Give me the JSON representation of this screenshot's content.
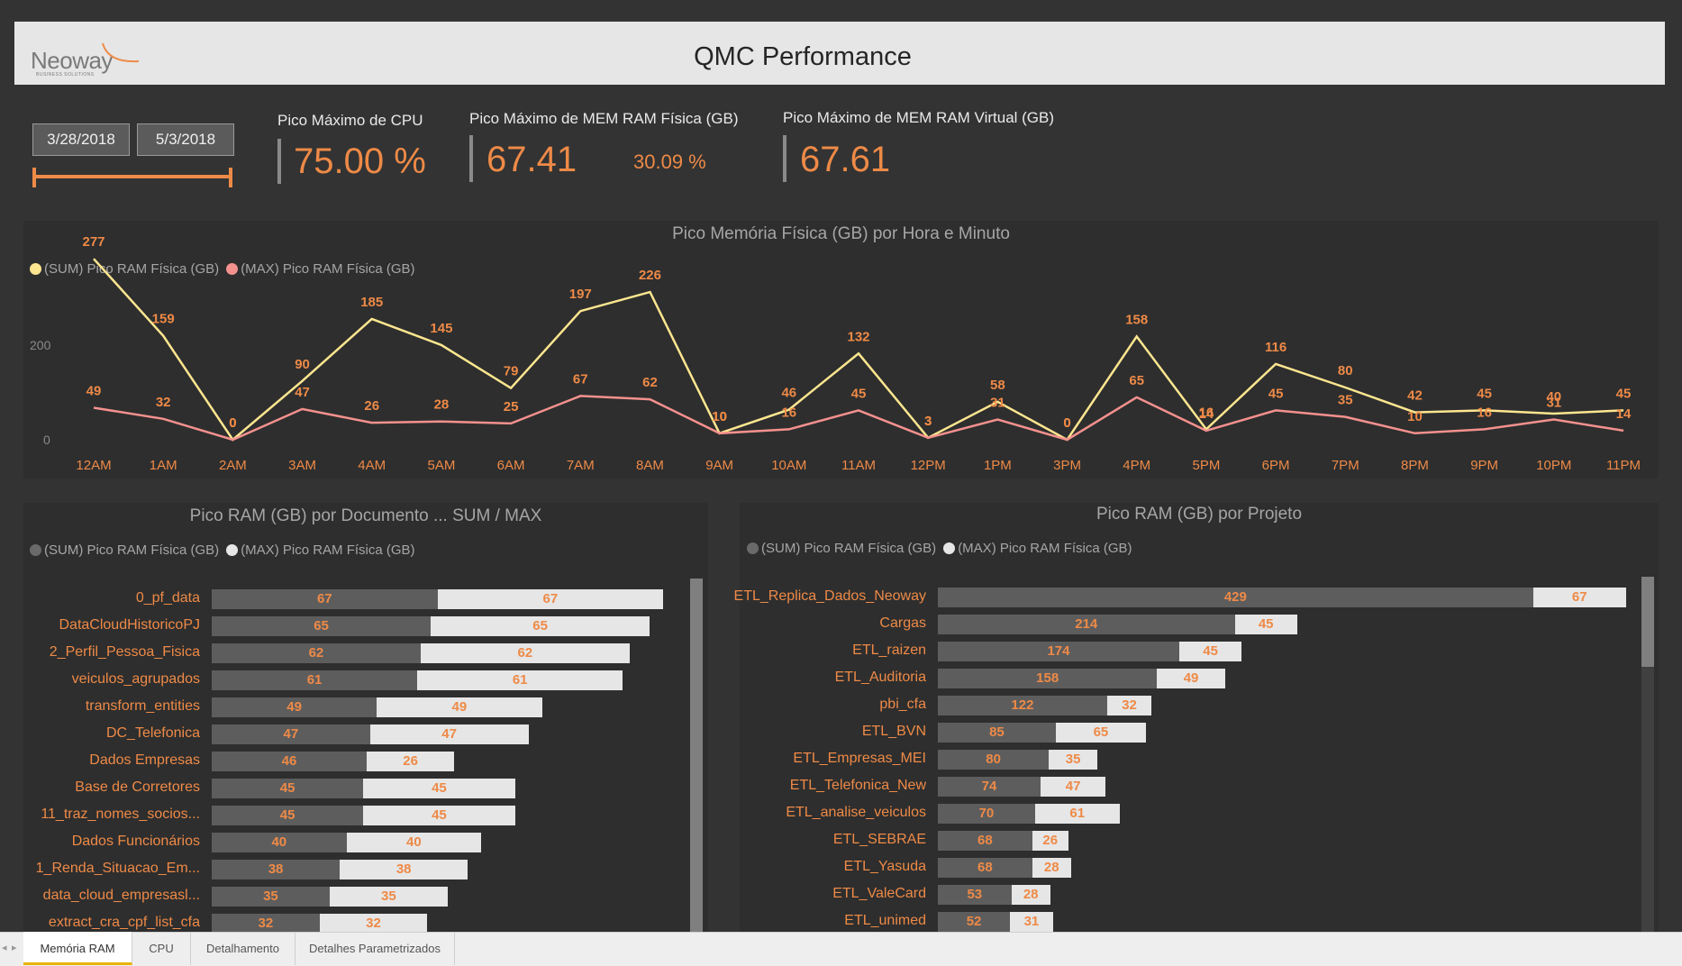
{
  "header": {
    "title": "QMC Performance",
    "logo_text": "Neoway",
    "logo_sub": "BUSINESS SOLUTIONS"
  },
  "slicer": {
    "start_date": "3/28/2018",
    "end_date": "5/3/2018"
  },
  "kpis": {
    "cpu_label": "Pico Máximo de CPU",
    "cpu_value": "75.00 %",
    "mem_fis_label": "Pico Máximo de MEM RAM Física (GB)",
    "mem_fis_value": "67.41",
    "mem_fis_pct": "30.09 %",
    "mem_virt_label": "Pico Máximo de MEM RAM Virtual (GB)",
    "mem_virt_value": "67.61"
  },
  "legend": {
    "sum": "(SUM) Pico RAM Física (GB)",
    "max": "(MAX) Pico RAM Física (GB)"
  },
  "colors": {
    "accent": "#ee8a47",
    "sum_line": "#fde68f",
    "max_line": "#f4918e",
    "sum_bar": "#5d5d5d",
    "max_bar": "#e6e6e6"
  },
  "chart_data": [
    {
      "type": "line",
      "title": "Pico Memória Física (GB) por Hora e Minuto",
      "x": [
        "12AM",
        "1AM",
        "2AM",
        "3AM",
        "4AM",
        "5AM",
        "6AM",
        "7AM",
        "8AM",
        "9AM",
        "10AM",
        "11AM",
        "12PM",
        "1PM",
        "3PM",
        "4PM",
        "5PM",
        "6PM",
        "7PM",
        "8PM",
        "9PM",
        "10PM",
        "11PM"
      ],
      "y_ticks": [
        "200",
        "0"
      ],
      "ylim": [
        0,
        290
      ],
      "series": [
        {
          "name": "(SUM) Pico RAM Física (GB)",
          "values": [
            277,
            159,
            0,
            90,
            185,
            145,
            79,
            197,
            226,
            10,
            46,
            132,
            3,
            58,
            0,
            158,
            16,
            116,
            80,
            42,
            45,
            40,
            45
          ]
        },
        {
          "name": "(MAX) Pico RAM Física (GB)",
          "values": [
            49,
            32,
            0,
            47,
            26,
            28,
            25,
            67,
            62,
            10,
            16,
            45,
            3,
            31,
            0,
            65,
            14,
            45,
            35,
            10,
            16,
            31,
            14
          ]
        }
      ]
    },
    {
      "type": "bar",
      "title": "Pico RAM (GB) por Documento ... SUM / MAX",
      "categories": [
        "0_pf_data",
        "DataCloudHistoricoPJ",
        "2_Perfil_Pessoa_Fisica",
        "veiculos_agrupados",
        "transform_entities",
        "DC_Telefonica",
        "Dados Empresas",
        "Base de Corretores",
        "11_traz_nomes_socios...",
        "Dados Funcionários",
        "1_Renda_Situacao_Em...",
        "data_cloud_empresasl...",
        "extract_cra_cpf_list_cfa"
      ],
      "series": [
        {
          "name": "(SUM) Pico RAM Física (GB)",
          "values": [
            67,
            65,
            62,
            61,
            49,
            47,
            46,
            45,
            45,
            40,
            38,
            35,
            32
          ]
        },
        {
          "name": "(MAX) Pico RAM Física (GB)",
          "values": [
            67,
            65,
            62,
            61,
            49,
            47,
            26,
            45,
            45,
            40,
            38,
            35,
            32
          ]
        }
      ]
    },
    {
      "type": "bar",
      "title": "Pico RAM (GB) por Projeto",
      "categories": [
        "ETL_Replica_Dados_Neoway",
        "Cargas",
        "ETL_raizen",
        "ETL_Auditoria",
        "pbi_cfa",
        "ETL_BVN",
        "ETL_Empresas_MEI",
        "ETL_Telefonica_New",
        "ETL_analise_veiculos",
        "ETL_SEBRAE",
        "ETL_Yasuda",
        "ETL_ValeCard",
        "ETL_unimed"
      ],
      "series": [
        {
          "name": "(SUM) Pico RAM Física (GB)",
          "values": [
            429,
            214,
            174,
            158,
            122,
            85,
            80,
            74,
            70,
            68,
            68,
            53,
            52
          ]
        },
        {
          "name": "(MAX) Pico RAM Física (GB)",
          "values": [
            67,
            45,
            45,
            49,
            32,
            65,
            35,
            47,
            61,
            26,
            28,
            28,
            31
          ]
        }
      ]
    }
  ],
  "tabs": [
    "Memória RAM",
    "CPU",
    "Detalhamento",
    "Detalhes Parametrizados"
  ],
  "nav_arrows": [
    "◂",
    "▸"
  ]
}
